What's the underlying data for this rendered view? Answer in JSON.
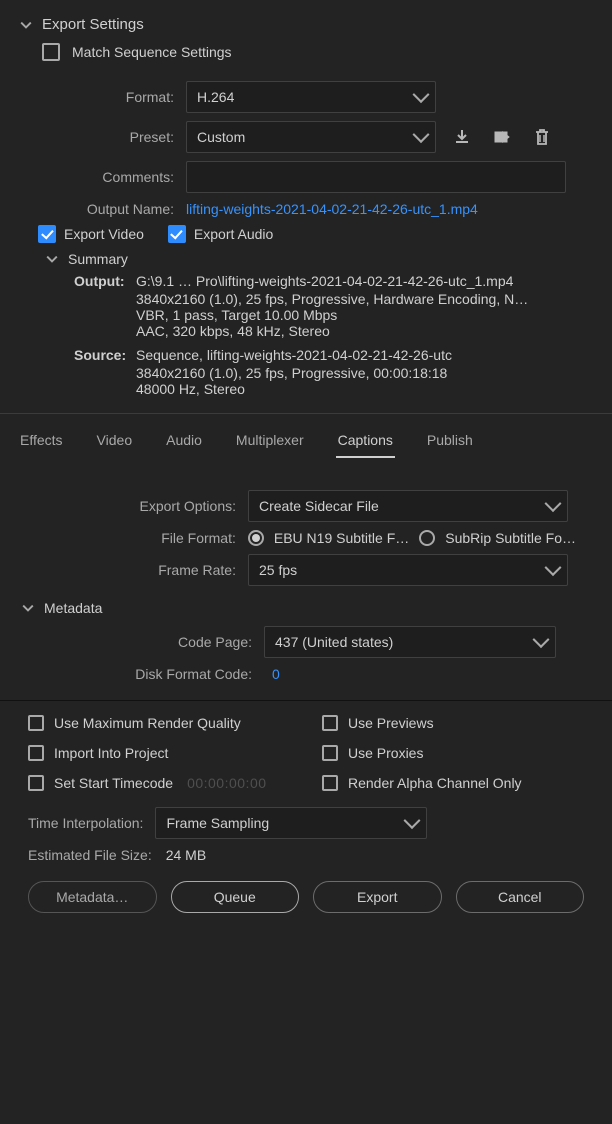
{
  "export_settings": {
    "title": "Export Settings",
    "match_sequence_label": "Match Sequence Settings",
    "match_sequence_checked": false,
    "format_label": "Format:",
    "format_value": "H.264",
    "preset_label": "Preset:",
    "preset_value": "Custom",
    "comments_label": "Comments:",
    "comments_value": "",
    "output_name_label": "Output Name:",
    "output_name_value": "lifting-weights-2021-04-02-21-42-26-utc_1.mp4",
    "export_video_label": "Export Video",
    "export_video_checked": true,
    "export_audio_label": "Export Audio",
    "export_audio_checked": true
  },
  "summary": {
    "title": "Summary",
    "output_label": "Output:",
    "output_lines": [
      "G:\\9.1 … Pro\\lifting-weights-2021-04-02-21-42-26-utc_1.mp4",
      "3840x2160 (1.0), 25 fps, Progressive, Hardware Encoding, N…",
      "VBR, 1 pass, Target 10.00 Mbps",
      "AAC, 320 kbps, 48 kHz, Stereo"
    ],
    "source_label": "Source:",
    "source_lines": [
      "Sequence, lifting-weights-2021-04-02-21-42-26-utc",
      "3840x2160 (1.0), 25 fps, Progressive, 00:00:18:18",
      "48000 Hz, Stereo"
    ]
  },
  "tabs": {
    "items": [
      "Effects",
      "Video",
      "Audio",
      "Multiplexer",
      "Captions",
      "Publish"
    ],
    "active_index": 4
  },
  "captions": {
    "export_options_label": "Export Options:",
    "export_options_value": "Create Sidecar File",
    "file_format_label": "File Format:",
    "file_format_options": [
      "EBU N19 Subtitle F…",
      "SubRip Subtitle Fo…"
    ],
    "file_format_selected_index": 0,
    "frame_rate_label": "Frame Rate:",
    "frame_rate_value": "25 fps",
    "metadata_title": "Metadata",
    "code_page_label": "Code Page:",
    "code_page_value": "437 (United states)",
    "disk_format_code_label": "Disk Format Code:",
    "disk_format_code_value": "0"
  },
  "footer": {
    "checks": [
      {
        "label": "Use Maximum Render Quality",
        "checked": false
      },
      {
        "label": "Use Previews",
        "checked": false
      },
      {
        "label": "Import Into Project",
        "checked": false
      },
      {
        "label": "Use Proxies",
        "checked": false
      },
      {
        "label": "Set Start Timecode",
        "checked": false,
        "placeholder": "00:00:00:00"
      },
      {
        "label": "Render Alpha Channel Only",
        "checked": false
      }
    ],
    "time_interpolation_label": "Time Interpolation:",
    "time_interpolation_value": "Frame Sampling",
    "estimated_label": "Estimated File Size:",
    "estimated_value": "24 MB",
    "buttons": {
      "metadata": "Metadata…",
      "queue": "Queue",
      "export": "Export",
      "cancel": "Cancel"
    }
  }
}
